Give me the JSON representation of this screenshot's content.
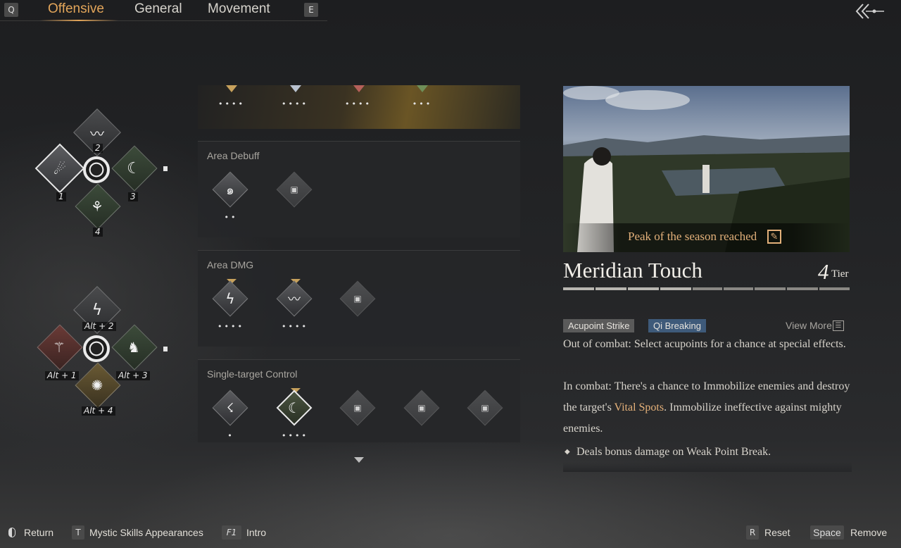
{
  "tabs": {
    "prev_key": "Q",
    "next_key": "E",
    "items": [
      "Offensive",
      "General",
      "Movement"
    ],
    "active": "Offensive"
  },
  "loadout_top": {
    "slots": [
      {
        "num": "1",
        "icon": "sword-figure-icon"
      },
      {
        "num": "2",
        "icon": "bird-strike-icon"
      },
      {
        "num": "3",
        "icon": "crescent-slash-icon"
      },
      {
        "num": "4",
        "icon": "whirl-figure-icon"
      }
    ]
  },
  "loadout_bottom": {
    "slots": [
      {
        "num": "Alt + 2",
        "icon": "lightning-slash-icon"
      },
      {
        "num": "Alt + 1",
        "icon": "flame-claw-icon"
      },
      {
        "num": "Alt + 3",
        "icon": "stance-figure-icon"
      },
      {
        "num": "Alt + 4",
        "icon": "spin-figure-icon"
      }
    ]
  },
  "categories": [
    {
      "title": "",
      "skills": [
        {
          "dots": "••••"
        },
        {
          "dots": "••••"
        },
        {
          "dots": "••••"
        },
        {
          "dots": "•••"
        }
      ]
    },
    {
      "title": "Area Debuff",
      "skills": [
        {
          "dots": "••",
          "icon": "vortex-icon"
        },
        {
          "dots": "",
          "icon": "locked-chest-icon"
        }
      ]
    },
    {
      "title": "Area DMG",
      "skills": [
        {
          "dots": "••••",
          "icon": "lightning-slash-icon"
        },
        {
          "dots": "••••",
          "icon": "bird-strike-icon"
        },
        {
          "dots": "",
          "icon": "locked-chest-icon"
        }
      ]
    },
    {
      "title": "Single-target Control",
      "skills": [
        {
          "dots": "•",
          "icon": "leaping-figure-icon"
        },
        {
          "dots": "••••",
          "icon": "crescent-slash-icon"
        },
        {
          "dots": "",
          "icon": "locked-chest-icon"
        },
        {
          "dots": "",
          "icon": "locked-chest-icon"
        },
        {
          "dots": "",
          "icon": "locked-chest-icon"
        }
      ]
    }
  ],
  "detail": {
    "banner": "Peak of the season reached",
    "name": "Meridian Touch",
    "tier_num": "4",
    "tier_label": "Tier",
    "tags": [
      "Acupoint Strike",
      "Qi Breaking"
    ],
    "view_more": "View More",
    "desc_line1": "Out of combat: Select acupoints for a chance at special effects.",
    "desc_line2a": "In combat: There's a chance to Immobilize enemies and destroy the target's ",
    "desc_highlight": "Vital Spots",
    "desc_line2b": ". Immobilize ineffective against mighty enemies.",
    "bullet1": "Deals bonus damage on Weak Point Break."
  },
  "bottom_bar": {
    "return": "Return",
    "appearance_key": "T",
    "appearance": "Mystic Skills Appearances",
    "intro_key": "F1",
    "intro": "Intro",
    "reset_key": "R",
    "reset": "Reset",
    "remove_key": "Space",
    "remove": "Remove"
  },
  "colors": {
    "accent": "#e2a55a",
    "tag_gray": "#5a5a5a",
    "tag_blue": "#3e5a7a"
  }
}
